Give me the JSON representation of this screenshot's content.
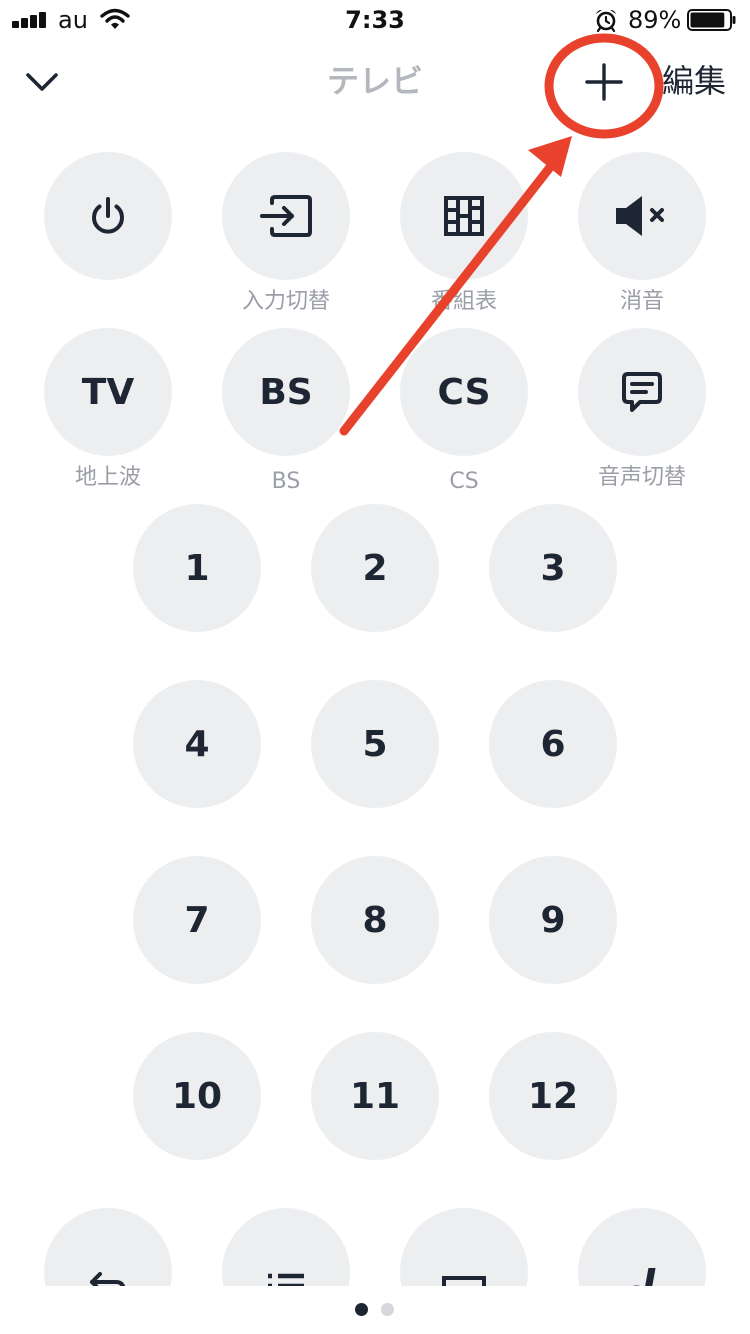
{
  "status_bar": {
    "carrier": "au",
    "time": "7:33",
    "battery_percent": "89%",
    "battery_level": 0.89,
    "icons": [
      "signal-icon",
      "wifi-icon",
      "alarm-icon",
      "battery-icon"
    ]
  },
  "nav": {
    "title": "テレビ",
    "edit_label": "編集",
    "icons": [
      "chevron-down-icon",
      "plus-icon"
    ]
  },
  "function_buttons": [
    {
      "icon": "power-icon",
      "caption": ""
    },
    {
      "icon": "input-switch-icon",
      "caption": "入力切替"
    },
    {
      "icon": "program-guide-icon",
      "caption": "番組表"
    },
    {
      "icon": "mute-icon",
      "caption": "消音"
    }
  ],
  "broadcast_buttons": [
    {
      "label": "TV",
      "caption": "地上波"
    },
    {
      "label": "BS",
      "caption": "BS"
    },
    {
      "label": "CS",
      "caption": "CS"
    },
    {
      "icon": "audio-switch-icon",
      "caption": "音声切替"
    }
  ],
  "number_buttons": [
    "1",
    "2",
    "3",
    "4",
    "5",
    "6",
    "7",
    "8",
    "9",
    "10",
    "11",
    "12"
  ],
  "bottom_row_icons": [
    "back-icon",
    "list-icon",
    "display-icon",
    "d-button-icon"
  ],
  "pager": {
    "pages": 2,
    "current": 1
  },
  "annotation": {
    "color": "#e8412c"
  },
  "colors": {
    "button_bg": "#edeef0",
    "text": "#1f2633",
    "caption": "#9a9ea6",
    "title": "#b4b7bd"
  }
}
